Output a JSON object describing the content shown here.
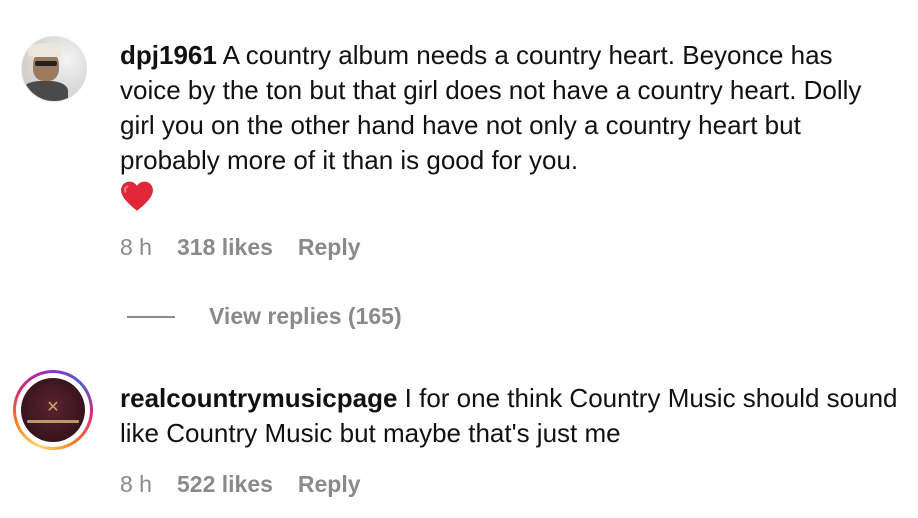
{
  "comments": [
    {
      "username": "dpj1961",
      "text": "A country album needs a country heart. Beyonce has voice by the ton but that girl does not have a country heart. Dolly girl you on the other hand have not only a country heart but probably more of it than is good for you.",
      "emoji": "red-heart",
      "time": "8 h",
      "likes": "318 likes",
      "reply_label": "Reply",
      "view_replies": "View replies (165)"
    },
    {
      "username": "realcountrymusicpage",
      "text": "I for one think Country Music should sound like Country Music but maybe that's just me",
      "time": "8 h",
      "likes": "522 likes",
      "reply_label": "Reply",
      "story_ring": true
    }
  ],
  "colors": {
    "meta_text": "#8a8a8a",
    "heart": "#e0273a"
  }
}
